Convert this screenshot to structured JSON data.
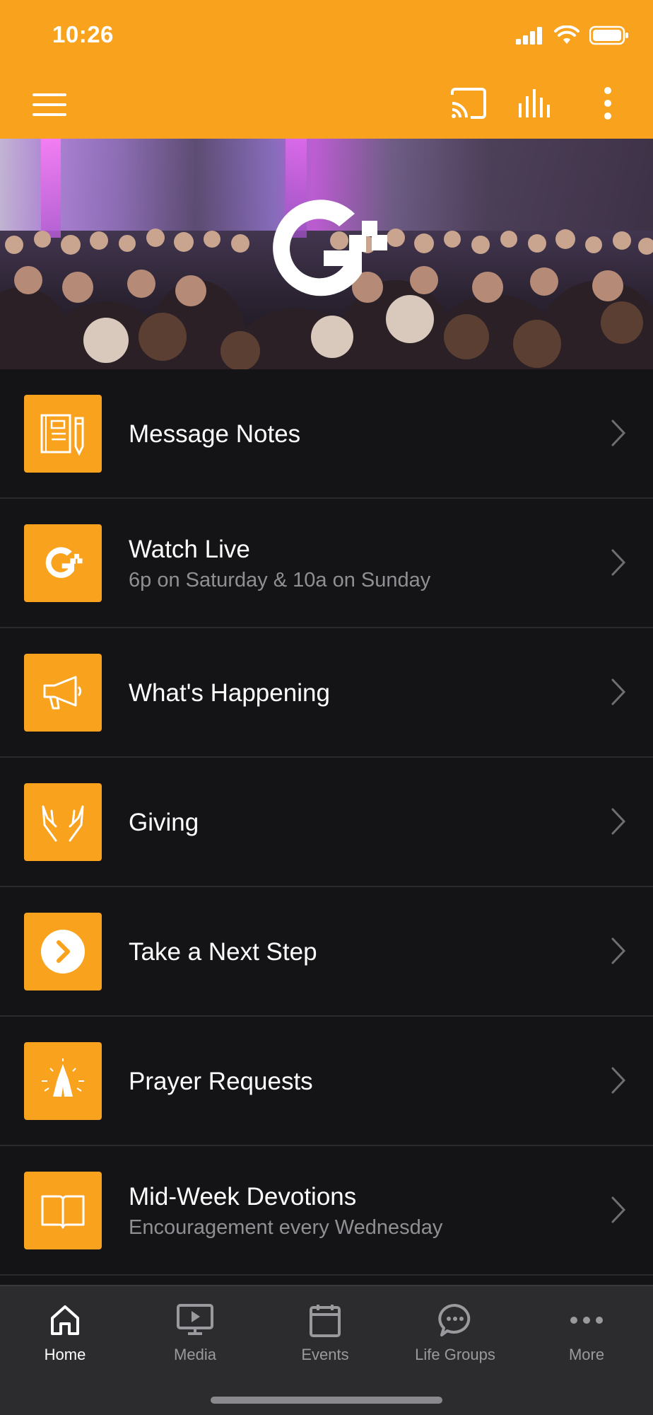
{
  "status": {
    "time": "10:26"
  },
  "appbar": {
    "menu_icon": "hamburger-icon",
    "cast_icon": "cast-icon",
    "audio_icon": "audio-bars-icon",
    "more_icon": "kebab-menu-icon"
  },
  "theme": {
    "accent": "#F8A21D",
    "background": "#141416",
    "tabbar": "#2c2c2e",
    "subtitle": "#8f8f94"
  },
  "menu": {
    "items": [
      {
        "title": "Message Notes",
        "subtitle": "",
        "icon": "notebook-pencil-icon"
      },
      {
        "title": "Watch Live",
        "subtitle": "6p on Saturday & 10a on Sunday",
        "icon": "church-logo-icon"
      },
      {
        "title": "What's Happening",
        "subtitle": "",
        "icon": "megaphone-icon"
      },
      {
        "title": "Giving",
        "subtitle": "",
        "icon": "open-hands-icon"
      },
      {
        "title": "Take a Next Step",
        "subtitle": "",
        "icon": "arrow-circle-icon"
      },
      {
        "title": "Prayer Requests",
        "subtitle": "",
        "icon": "praying-hands-icon"
      },
      {
        "title": "Mid-Week Devotions",
        "subtitle": "Encouragement every Wednesday",
        "icon": "open-book-icon"
      }
    ]
  },
  "tabs": [
    {
      "label": "Home",
      "icon": "home-icon",
      "active": true
    },
    {
      "label": "Media",
      "icon": "tv-play-icon",
      "active": false
    },
    {
      "label": "Events",
      "icon": "calendar-icon",
      "active": false
    },
    {
      "label": "Life Groups",
      "icon": "chat-bubble-icon",
      "active": false
    },
    {
      "label": "More",
      "icon": "ellipsis-icon",
      "active": false
    }
  ]
}
